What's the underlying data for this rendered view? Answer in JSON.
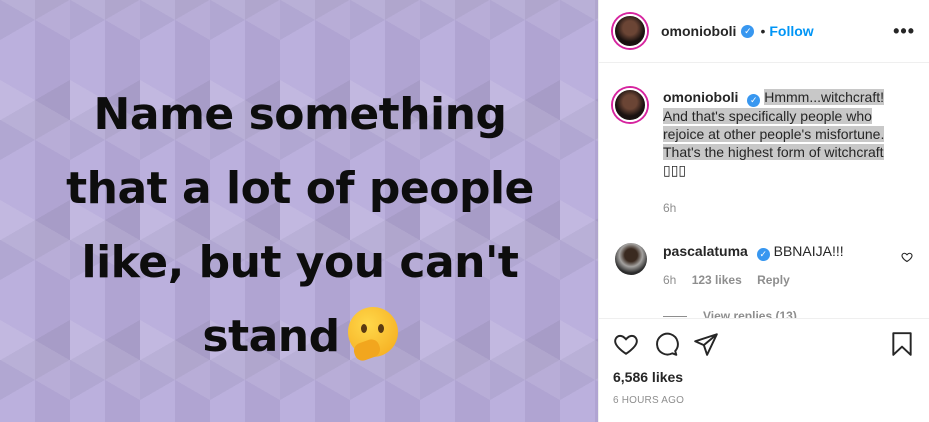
{
  "post": {
    "image_text": "Name something that a lot of people like, but you can't stand",
    "image_lines": [
      "Name something",
      "that a lot of people",
      "like, but you can't",
      "stand"
    ]
  },
  "header": {
    "username": "omonioboli",
    "dot": "•",
    "follow": "Follow",
    "more": "•••"
  },
  "caption": {
    "username": "omonioboli",
    "text": "Hmmm...witchcraft! And that's specifically people who rejoice at other people's misfortune. That's the highest form of witchcraft",
    "emoji_placeholder": "▯▯▯",
    "time": "6h"
  },
  "comment": {
    "username": "pascalatuma",
    "text": "BBNAIJA!!!",
    "time": "6h",
    "likes": "123 likes",
    "reply": "Reply",
    "view_replies": "View replies (13)"
  },
  "actions": {
    "likes": "6,586 likes",
    "posted": "6 HOURS AGO"
  },
  "colors": {
    "accent": "#0095f6",
    "verified": "#3897f0",
    "image_bg": "#b7abdb"
  }
}
